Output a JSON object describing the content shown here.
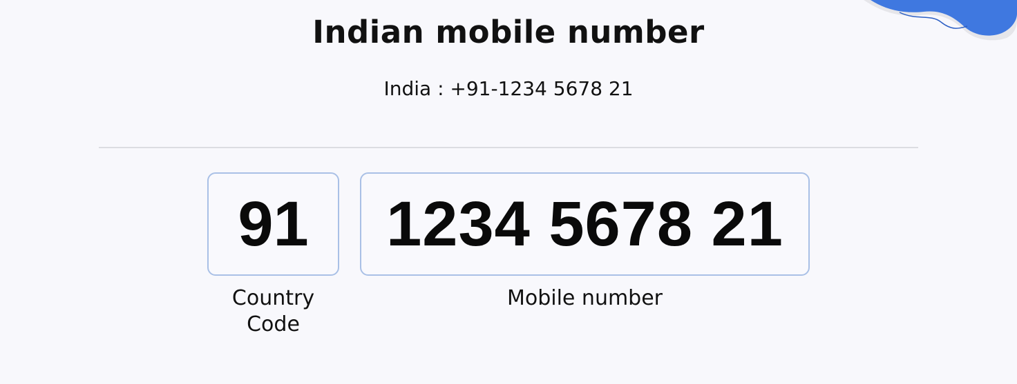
{
  "page": {
    "title": "Indian mobile number",
    "subtitle": "India : +91-1234 5678 21"
  },
  "fields": {
    "country_code": {
      "value": "91",
      "label_line1": "Country",
      "label_line2": "Code"
    },
    "mobile_number": {
      "value": "1234 5678 21",
      "label": "Mobile number"
    }
  },
  "colors": {
    "background": "#f8f8fc",
    "box_border": "#a9c0e6",
    "divider": "#dcdde2",
    "accent_blob": "#3f78e0"
  },
  "icons": {
    "corner_decoration": "wave-blob"
  }
}
